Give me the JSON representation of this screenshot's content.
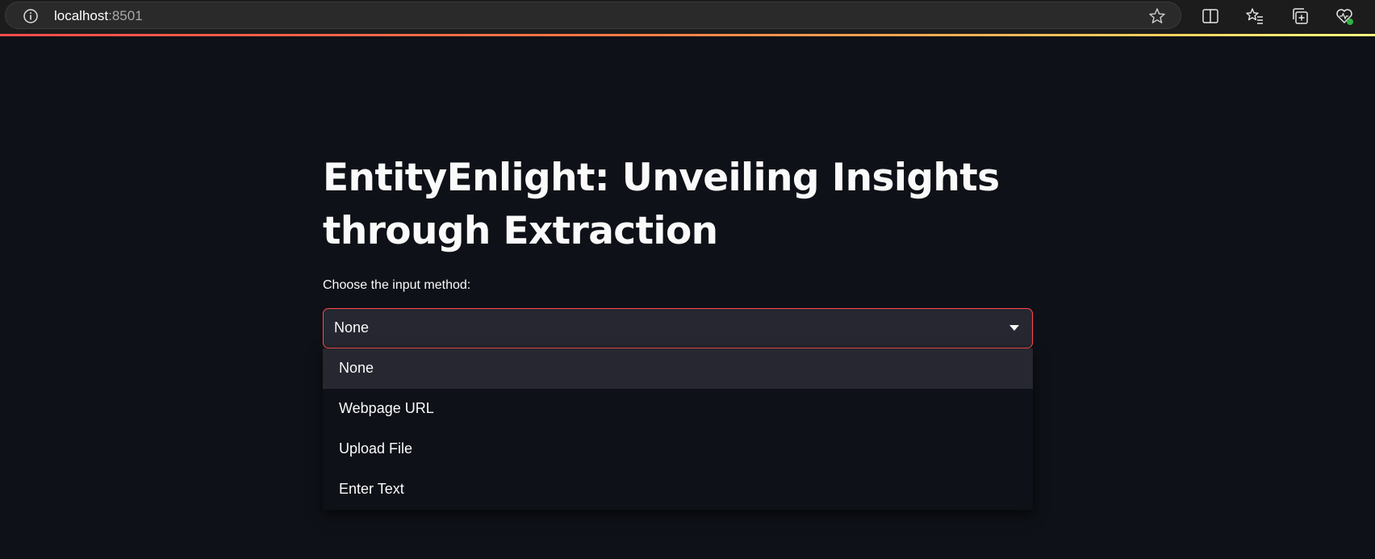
{
  "browser": {
    "url_host": "localhost",
    "url_port": ":8501",
    "icons": [
      "info-icon",
      "favorite-star-icon",
      "split-screen-icon",
      "favorites-icon",
      "collections-icon",
      "browser-essentials-icon"
    ]
  },
  "app": {
    "title": "EntityEnlight: Unveiling Insights through Extraction",
    "select_label": "Choose the input method:",
    "selected_value": "None",
    "options": [
      {
        "label": "None",
        "highlighted": true
      },
      {
        "label": "Webpage URL"
      },
      {
        "label": "Upload File"
      },
      {
        "label": "Enter Text"
      }
    ]
  },
  "colors": {
    "background": "#0e1117",
    "accent": "#ff4b4b",
    "widget_bg": "#262730",
    "text": "#fafafa"
  }
}
